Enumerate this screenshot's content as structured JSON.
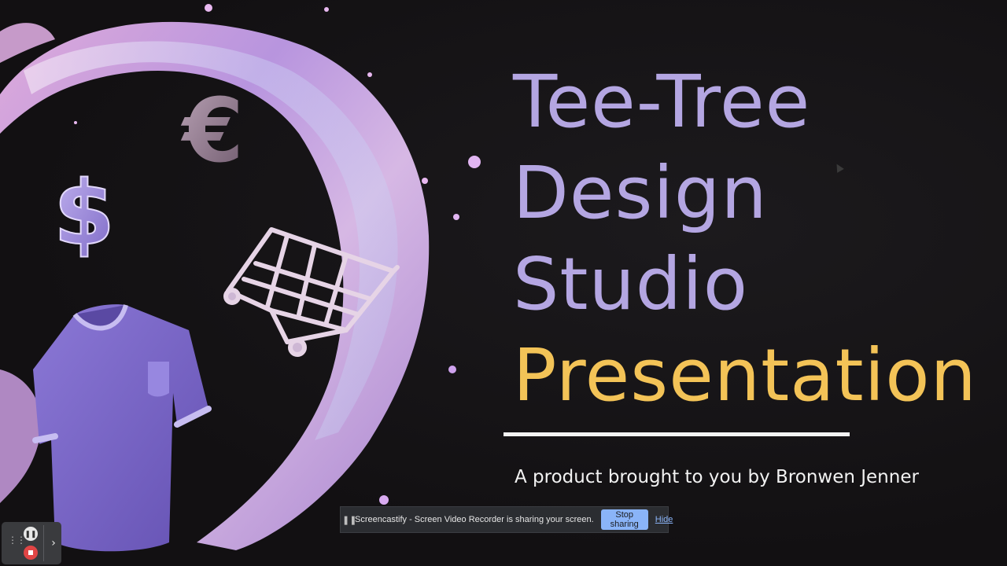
{
  "slide": {
    "title_lines": [
      "Tee-Tree",
      "Design",
      "Studio",
      "Presentation"
    ],
    "subtitle": "A product brought to you by Bronwen Jenner",
    "colors": {
      "title": "#b4a6e2",
      "accent": "#f3c357",
      "background": "#141214"
    }
  },
  "art": {
    "dollar_glyph": "$",
    "euro_glyph": "€",
    "icons": [
      "water-splash",
      "dollar-icon",
      "euro-icon",
      "shopping-cart-icon",
      "tshirt-icon"
    ]
  },
  "share_bar": {
    "message": "Screencastify - Screen Video Recorder is sharing your screen.",
    "stop_label": "Stop sharing",
    "hide_label": "Hide"
  },
  "recorder": {
    "icons": [
      "drag-handle-icon",
      "pause-icon",
      "stop-icon",
      "chevron-right-icon"
    ],
    "pause_glyph": "❚❚",
    "expand_glyph": "›"
  }
}
